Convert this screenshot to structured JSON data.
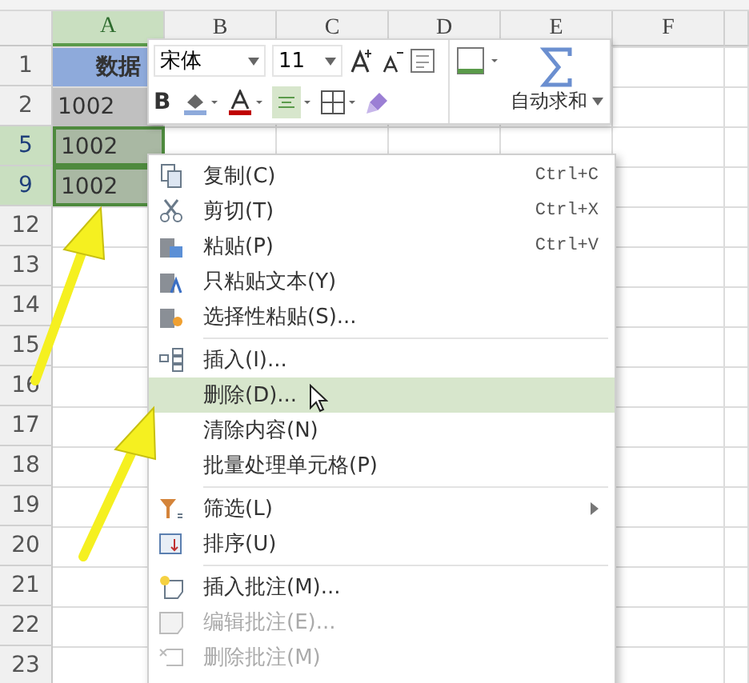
{
  "columns": [
    {
      "label": "A",
      "selected": true
    },
    {
      "label": "B",
      "selected": false
    },
    {
      "label": "C",
      "selected": false
    },
    {
      "label": "D",
      "selected": false
    },
    {
      "label": "E",
      "selected": false
    },
    {
      "label": "F",
      "selected": false
    }
  ],
  "rows": [
    {
      "header": "1",
      "selected": false,
      "cells": [
        {
          "value": "数据",
          "kind": "title"
        }
      ]
    },
    {
      "header": "2",
      "selected": false,
      "cells": [
        {
          "value": "1002",
          "kind": "grey"
        }
      ]
    },
    {
      "header": "5",
      "selected": true,
      "cells": [
        {
          "value": "1002",
          "kind": "selected"
        }
      ]
    },
    {
      "header": "9",
      "selected": true,
      "cells": [
        {
          "value": "1002",
          "kind": "selected"
        }
      ]
    },
    {
      "header": "12",
      "selected": false,
      "cells": []
    },
    {
      "header": "13",
      "selected": false,
      "cells": []
    },
    {
      "header": "14",
      "selected": false,
      "cells": []
    },
    {
      "header": "15",
      "selected": false,
      "cells": []
    },
    {
      "header": "16",
      "selected": false,
      "cells": []
    },
    {
      "header": "17",
      "selected": false,
      "cells": []
    },
    {
      "header": "18",
      "selected": false,
      "cells": []
    },
    {
      "header": "19",
      "selected": false,
      "cells": []
    },
    {
      "header": "20",
      "selected": false,
      "cells": []
    },
    {
      "header": "21",
      "selected": false,
      "cells": []
    },
    {
      "header": "22",
      "selected": false,
      "cells": []
    },
    {
      "header": "23",
      "selected": false,
      "cells": []
    }
  ],
  "mini_toolbar": {
    "font": "宋体",
    "size": "11",
    "sum_label": "自动求和",
    "bold": "B"
  },
  "context_menu": [
    {
      "label": "复制(C)",
      "shortcut": "Ctrl+C",
      "kind": "copy",
      "selected": false,
      "disabled": false
    },
    {
      "label": "剪切(T)",
      "shortcut": "Ctrl+X",
      "kind": "cut",
      "selected": false,
      "disabled": false
    },
    {
      "label": "粘贴(P)",
      "shortcut": "Ctrl+V",
      "kind": "paste",
      "selected": false,
      "disabled": false
    },
    {
      "label": "只粘贴文本(Y)",
      "kind": "paste-text",
      "selected": false,
      "disabled": false
    },
    {
      "label": "选择性粘贴(S)...",
      "kind": "paste-special",
      "selected": false,
      "disabled": false
    },
    {
      "label": "插入(I)...",
      "kind": "insert",
      "separator_before": true,
      "selected": false,
      "disabled": false
    },
    {
      "label": "删除(D)...",
      "kind": "plain",
      "selected": true,
      "disabled": false
    },
    {
      "label": "清除内容(N)",
      "kind": "plain",
      "selected": false,
      "disabled": false
    },
    {
      "label": "批量处理单元格(P)",
      "kind": "plain",
      "selected": false,
      "disabled": false
    },
    {
      "label": "筛选(L)",
      "kind": "filter",
      "separator_before": true,
      "submenu": true,
      "selected": false,
      "disabled": false
    },
    {
      "label": "排序(U)",
      "kind": "sort",
      "selected": false,
      "disabled": false
    },
    {
      "label": "插入批注(M)...",
      "kind": "note-add",
      "separator_before": true,
      "selected": false,
      "disabled": false
    },
    {
      "label": "编辑批注(E)...",
      "kind": "note-edit",
      "selected": false,
      "disabled": true
    },
    {
      "label": "删除批注(M)",
      "kind": "note-delete",
      "selected": false,
      "disabled": true
    }
  ]
}
